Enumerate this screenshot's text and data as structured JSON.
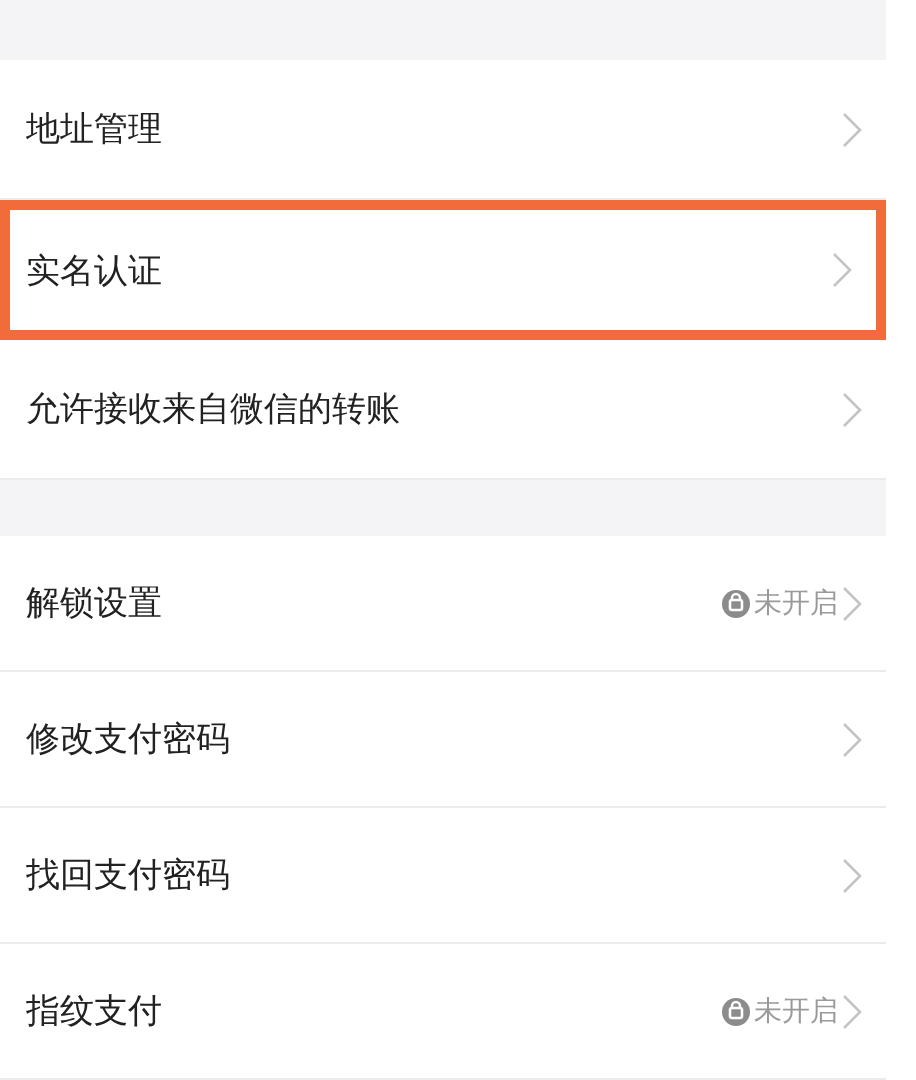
{
  "sections": [
    {
      "items": [
        {
          "label": "地址管理",
          "highlighted": false
        },
        {
          "label": "实名认证",
          "highlighted": true
        },
        {
          "label": "允许接收来自微信的转账",
          "highlighted": false
        }
      ]
    },
    {
      "items": [
        {
          "label": "解锁设置",
          "highlighted": false,
          "status": "未开启"
        },
        {
          "label": "修改支付密码",
          "highlighted": false
        },
        {
          "label": "找回支付密码",
          "highlighted": false
        },
        {
          "label": "指纹支付",
          "highlighted": false,
          "status": "未开启"
        }
      ]
    }
  ]
}
